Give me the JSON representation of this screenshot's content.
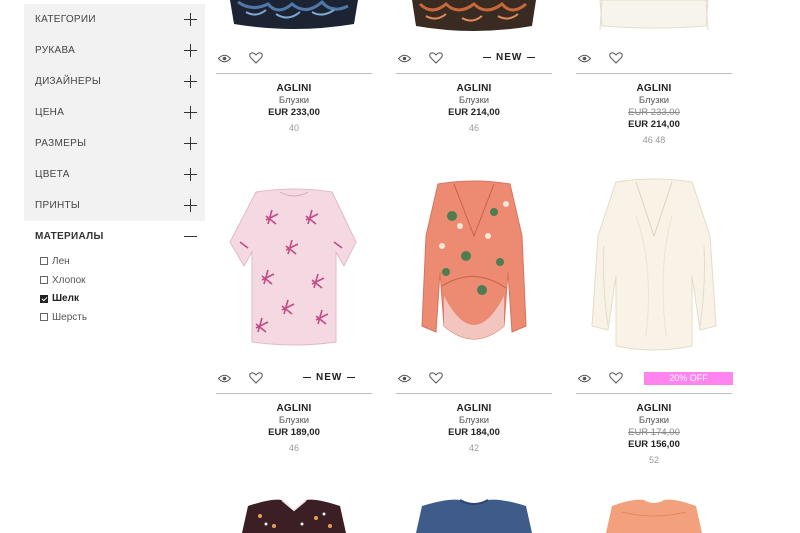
{
  "filters": {
    "categories": "КАТЕГОРИИ",
    "sleeves": "РУКАВА",
    "designers": "ДИЗАЙНЕРЫ",
    "price": "ЦЕНА",
    "sizes": "РАЗМЕРЫ",
    "colors": "ЦВЕТА",
    "prints": "ПРИНТЫ",
    "materials": "МАТЕРИАЛЫ",
    "materials_options": [
      "Лен",
      "Хлопок",
      "Шелк",
      "Шерсть"
    ]
  },
  "badges": {
    "new": "NEW",
    "off": "20% OFF"
  },
  "products": [
    {
      "brand": "AGLINI",
      "category": "Блузки",
      "price": "EUR 233,00",
      "sizes": "40"
    },
    {
      "brand": "AGLINI",
      "category": "Блузки",
      "price": "EUR 214,00",
      "sizes": "46"
    },
    {
      "brand": "AGLINI",
      "category": "Блузки",
      "old_price": "EUR 233,00",
      "price": "EUR 214,00",
      "sizes": "46  48"
    },
    {
      "brand": "AGLINI",
      "category": "Блузки",
      "price": "EUR 189,00",
      "sizes": "46"
    },
    {
      "brand": "AGLINI",
      "category": "Блузки",
      "price": "EUR 184,00",
      "sizes": "42"
    },
    {
      "brand": "AGLINI",
      "category": "Блузки",
      "old_price": "EUR 174,00",
      "price": "EUR 156,00",
      "sizes": "52"
    }
  ],
  "colors": {
    "sale_badge": "#ff84f0",
    "rule": "#bdbdbd",
    "sidebar_bg": "#f2f2f2"
  }
}
